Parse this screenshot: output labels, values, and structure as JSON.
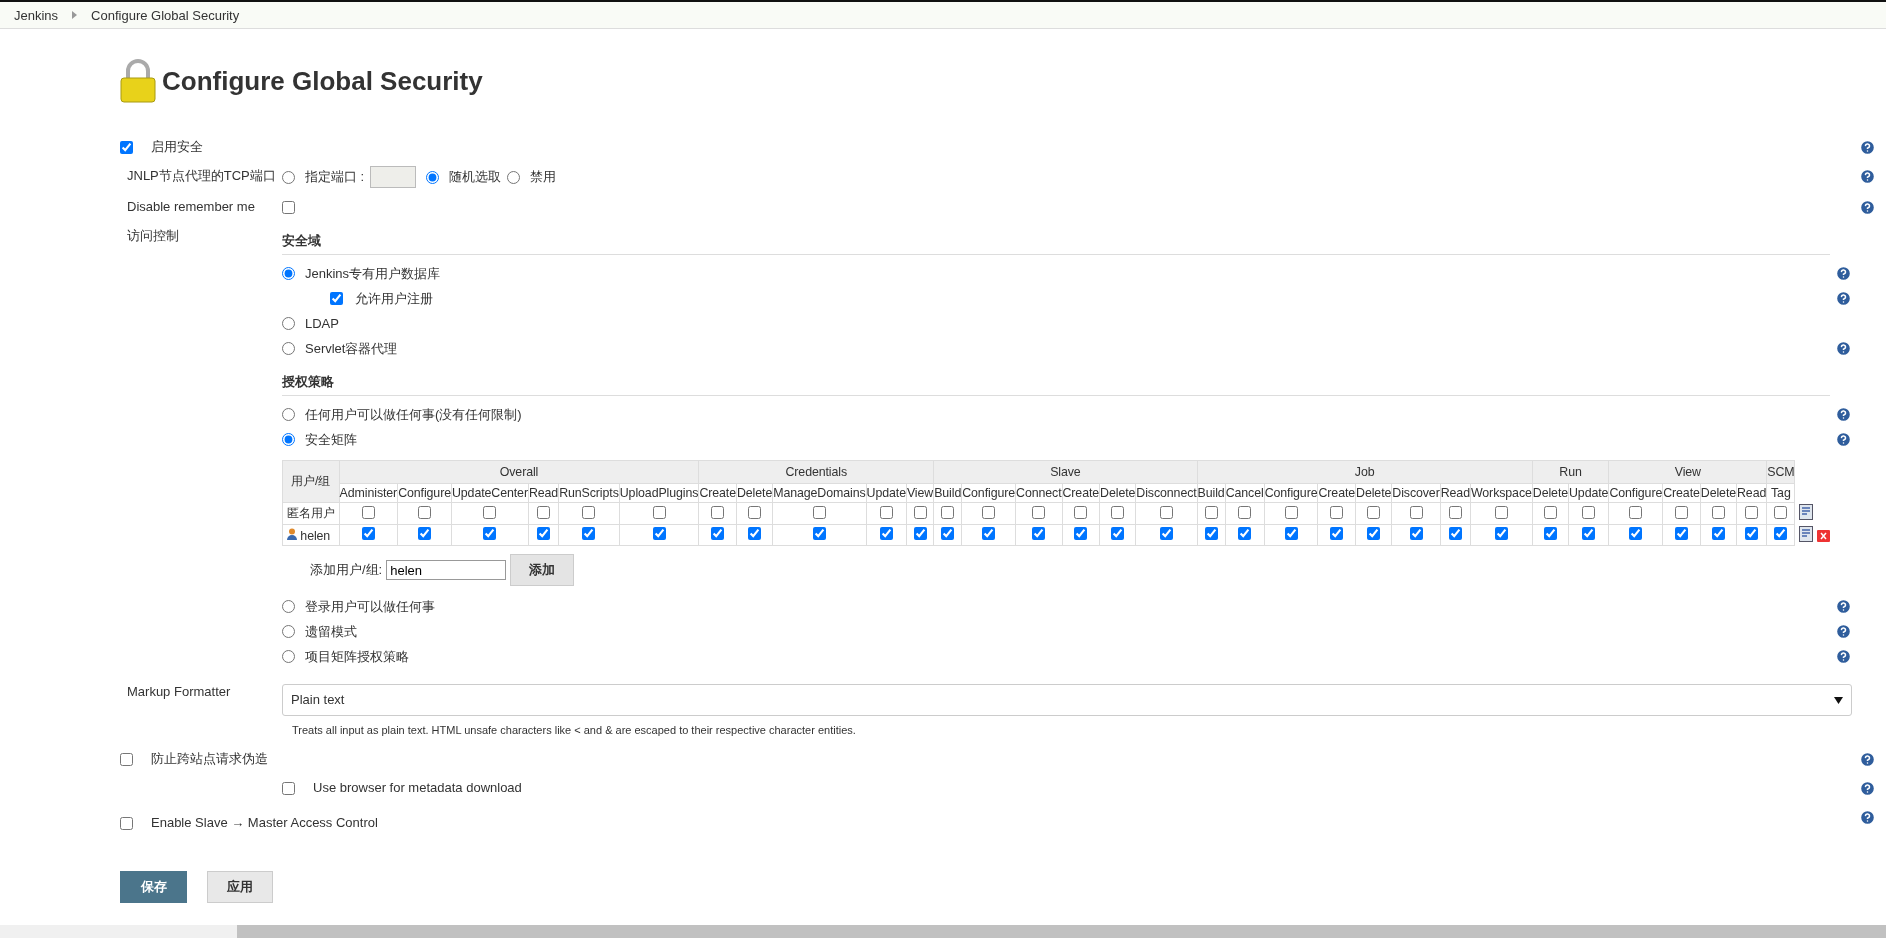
{
  "breadcrumbs": [
    {
      "label": "Jenkins"
    },
    {
      "label": "Configure Global Security"
    }
  ],
  "title": "Configure Global Security",
  "enable_security": {
    "label": "启用安全",
    "checked": true
  },
  "jnlp": {
    "label": "JNLP节点代理的TCP端口",
    "options": [
      {
        "kind": "port",
        "label": "指定端口 :",
        "selected": false
      },
      {
        "kind": "plain",
        "label": "随机选取",
        "selected": true
      },
      {
        "kind": "plain",
        "label": "禁用",
        "selected": false
      }
    ]
  },
  "disable_remember_me": {
    "label": "Disable remember me",
    "checked": false
  },
  "access_control": {
    "label": "访问控制",
    "security_realm": {
      "heading": "安全域",
      "options": [
        {
          "label": "Jenkins专有用户数据库",
          "selected": true,
          "children": [
            {
              "label": "允许用户注册",
              "checked": true
            }
          ]
        },
        {
          "label": "LDAP",
          "selected": false
        },
        {
          "label": "Servlet容器代理",
          "selected": false
        }
      ]
    },
    "authorization": {
      "heading": "授权策略",
      "options": [
        {
          "kind": "plain",
          "label": "任何用户可以做任何事(没有任何限制)",
          "selected": false
        },
        {
          "kind": "matrix",
          "label": "安全矩阵",
          "selected": true,
          "matrix": {
            "corner": "用户/组",
            "groups": [
              {
                "name": "Overall",
                "columns": [
                  "Administer",
                  "Configure",
                  "UpdateCenter",
                  "Read",
                  "RunScripts",
                  "UploadPlugins"
                ]
              },
              {
                "name": "Credentials",
                "columns": [
                  "Create",
                  "Delete",
                  "ManageDomains",
                  "Update",
                  "View"
                ]
              },
              {
                "name": "Slave",
                "columns": [
                  "Build",
                  "Configure",
                  "Connect",
                  "Create",
                  "Delete",
                  "Disconnect"
                ]
              },
              {
                "name": "Job",
                "columns": [
                  "Build",
                  "Cancel",
                  "Configure",
                  "Create",
                  "Delete",
                  "Discover",
                  "Read",
                  "Workspace"
                ]
              },
              {
                "name": "Run",
                "columns": [
                  "Delete",
                  "Update"
                ]
              },
              {
                "name": "View",
                "columns": [
                  "Configure",
                  "Create",
                  "Delete",
                  "Read"
                ]
              },
              {
                "name": "SCM",
                "columns": [
                  "Tag"
                ]
              }
            ],
            "rows": [
              {
                "kind": "anonymous",
                "name": "匿名用户",
                "checked": [
                  false,
                  false,
                  false,
                  false,
                  false,
                  false,
                  false,
                  false,
                  false,
                  false,
                  false,
                  false,
                  false,
                  false,
                  false,
                  false,
                  false,
                  false,
                  false,
                  false,
                  false,
                  false,
                  false,
                  false,
                  false,
                  false,
                  false,
                  false,
                  false,
                  false,
                  false,
                  false
                ]
              },
              {
                "kind": "user",
                "name": "helen",
                "checked": [
                  true,
                  true,
                  true,
                  true,
                  true,
                  true,
                  true,
                  true,
                  true,
                  true,
                  true,
                  true,
                  true,
                  true,
                  true,
                  true,
                  true,
                  true,
                  true,
                  true,
                  true,
                  true,
                  true,
                  true,
                  true,
                  true,
                  true,
                  true,
                  true,
                  true,
                  true,
                  true
                ]
              }
            ],
            "add_user": {
              "label": "添加用户/组:",
              "value": "helen",
              "button": "添加"
            }
          }
        },
        {
          "kind": "plain",
          "label": "登录用户可以做任何事",
          "selected": false
        },
        {
          "kind": "plain",
          "label": "遗留模式",
          "selected": false
        },
        {
          "kind": "plain",
          "label": "项目矩阵授权策略",
          "selected": false
        }
      ]
    }
  },
  "markup_formatter": {
    "label": "Markup Formatter",
    "value": "Plain text",
    "description": "Treats all input as plain text. HTML unsafe characters like < and & are escaped to their respective character entities."
  },
  "csrf": {
    "label": "防止跨站点请求伪造",
    "checked": false,
    "children": [
      {
        "label": "Use browser for metadata download",
        "checked": false
      }
    ]
  },
  "slave_master": {
    "label": "Enable Slave → Master Access Control",
    "checked": false
  },
  "buttons": [
    {
      "kind": "primary",
      "label": "保存"
    },
    {
      "kind": "secondary",
      "label": "应用"
    }
  ]
}
